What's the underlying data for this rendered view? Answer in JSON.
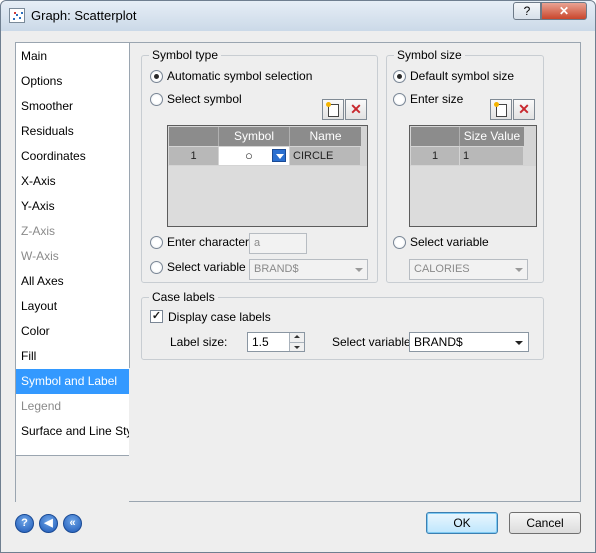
{
  "window": {
    "title": "Graph: Scatterplot",
    "help_label": "?",
    "close_label": "✕"
  },
  "sidebar": {
    "items": [
      {
        "label": "Main",
        "state": "normal"
      },
      {
        "label": "Options",
        "state": "normal"
      },
      {
        "label": "Smoother",
        "state": "normal"
      },
      {
        "label": "Residuals",
        "state": "normal"
      },
      {
        "label": "Coordinates",
        "state": "normal"
      },
      {
        "label": "X-Axis",
        "state": "normal"
      },
      {
        "label": "Y-Axis",
        "state": "normal"
      },
      {
        "label": "Z-Axis",
        "state": "disabled"
      },
      {
        "label": "W-Axis",
        "state": "disabled"
      },
      {
        "label": "All Axes",
        "state": "normal"
      },
      {
        "label": "Layout",
        "state": "normal"
      },
      {
        "label": "Color",
        "state": "normal"
      },
      {
        "label": "Fill",
        "state": "normal"
      },
      {
        "label": "Symbol and Label",
        "state": "selected"
      },
      {
        "label": "Legend",
        "state": "disabled"
      },
      {
        "label": "Surface and Line Style",
        "state": "normal"
      }
    ]
  },
  "symbol_type": {
    "title": "Symbol type",
    "automatic_label": "Automatic symbol selection",
    "select_symbol_label": "Select symbol",
    "table": {
      "headers": [
        "Symbol",
        "Name"
      ],
      "row_number": "1",
      "symbol_glyph": "○",
      "name": "CIRCLE"
    },
    "enter_character_label": "Enter character",
    "character_value": "a",
    "select_variable_label": "Select variable",
    "variable_value": "BRAND$"
  },
  "symbol_size": {
    "title": "Symbol size",
    "default_label": "Default symbol size",
    "enter_size_label": "Enter size",
    "table": {
      "header": "Size Value",
      "row_number": "1",
      "value": "1"
    },
    "select_variable_label": "Select variable",
    "variable_value": "CALORIES"
  },
  "case_labels": {
    "title": "Case labels",
    "display_label": "Display case labels",
    "display_checked": true,
    "label_size_label": "Label size:",
    "label_size_value": "1.5",
    "select_variable_label": "Select variable:",
    "variable_value": "BRAND$"
  },
  "footer": {
    "help_glyph": "?",
    "back_glyph": "◀",
    "first_glyph": "«",
    "ok_label": "OK",
    "cancel_label": "Cancel"
  },
  "colors": {
    "selected": "#3399ff",
    "accent": "#1c57b6"
  }
}
